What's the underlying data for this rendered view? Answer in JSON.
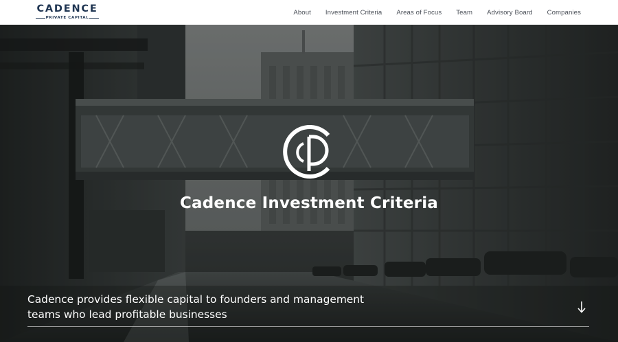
{
  "header": {
    "logo": {
      "word": "CADENCE",
      "sub": "PRIVATE CAPITAL"
    },
    "nav": [
      {
        "label": "About"
      },
      {
        "label": "Investment Criteria"
      },
      {
        "label": "Areas of Focus"
      },
      {
        "label": "Team"
      },
      {
        "label": "Advisory Board"
      },
      {
        "label": "Companies"
      }
    ]
  },
  "hero": {
    "title": "Cadence Investment Criteria",
    "tagline_line1": "Cadence provides flexible capital to founders and management",
    "tagline_line2": "teams who lead profitable businesses",
    "monogram_icon": "cadence-cp-monogram-icon",
    "scroll_icon": "arrow-down-icon"
  },
  "colors": {
    "brand_navy": "#1f3552",
    "nav_text": "#4a4f57",
    "hero_text": "#ffffff"
  }
}
